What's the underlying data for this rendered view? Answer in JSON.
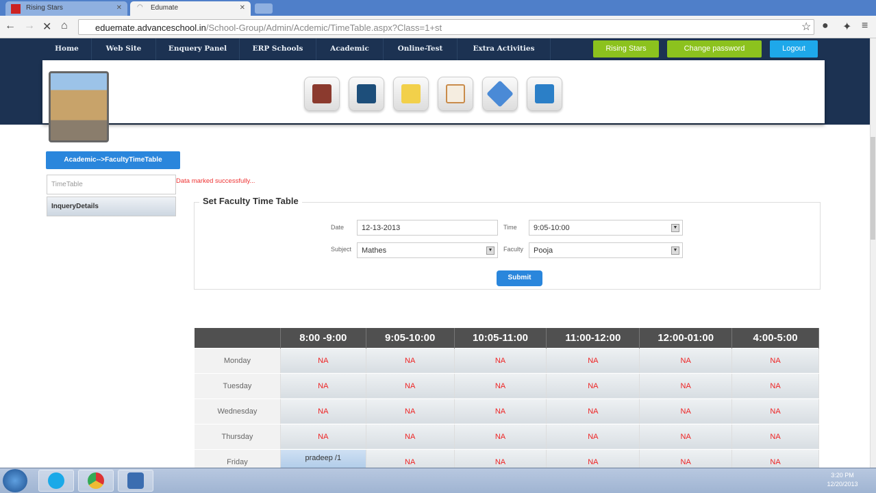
{
  "browser": {
    "tabs": [
      {
        "label": "Rising Stars"
      },
      {
        "label": "Edumate"
      }
    ],
    "url_host": "eduemate.advanceschool.in",
    "url_path": "/School-Group/Admin/Acdemic/TimeTable.aspx?Class=1+st"
  },
  "nav": {
    "items": [
      "Home",
      "Web Site",
      "Enquery Panel",
      "ERP Schools",
      "Academic",
      "Online-Test",
      "Extra Activities"
    ],
    "rising_stars": "Rising Stars",
    "change_password": "Change password",
    "logout": "Logout"
  },
  "sidebar": {
    "breadcrumb": "Academic-->FacultyTimeTable",
    "items": [
      "TimeTable",
      "InqueryDetails"
    ]
  },
  "message": "Data marked successfully...",
  "form": {
    "legend": "Set Faculty Time Table",
    "date_label": "Date",
    "date_value": "12-13-2013",
    "time_label": "Time",
    "time_value": "9:05-10:00",
    "subject_label": "Subject",
    "subject_value": "Mathes",
    "faculty_label": "Faculty",
    "faculty_value": "Pooja",
    "submit": "Submit"
  },
  "timetable": {
    "columns": [
      "8:00 -9:00",
      "9:05-10:00",
      "10:05-11:00",
      "11:00-12:00",
      "12:00-01:00",
      "4:00-5:00"
    ],
    "rows": [
      {
        "day": "Monday",
        "cells": [
          "NA",
          "NA",
          "NA",
          "NA",
          "NA",
          "NA"
        ]
      },
      {
        "day": "Tuesday",
        "cells": [
          "NA",
          "NA",
          "NA",
          "NA",
          "NA",
          "NA"
        ]
      },
      {
        "day": "Wednesday",
        "cells": [
          "NA",
          "NA",
          "NA",
          "NA",
          "NA",
          "NA"
        ]
      },
      {
        "day": "Thursday",
        "cells": [
          "NA",
          "NA",
          "NA",
          "NA",
          "NA",
          "NA"
        ]
      },
      {
        "day": "Friday",
        "cells": [
          "pradeep /1",
          "NA",
          "NA",
          "NA",
          "NA",
          "NA"
        ]
      }
    ]
  },
  "taskbar": {
    "time": "3:20 PM",
    "date": "12/20/2013"
  }
}
